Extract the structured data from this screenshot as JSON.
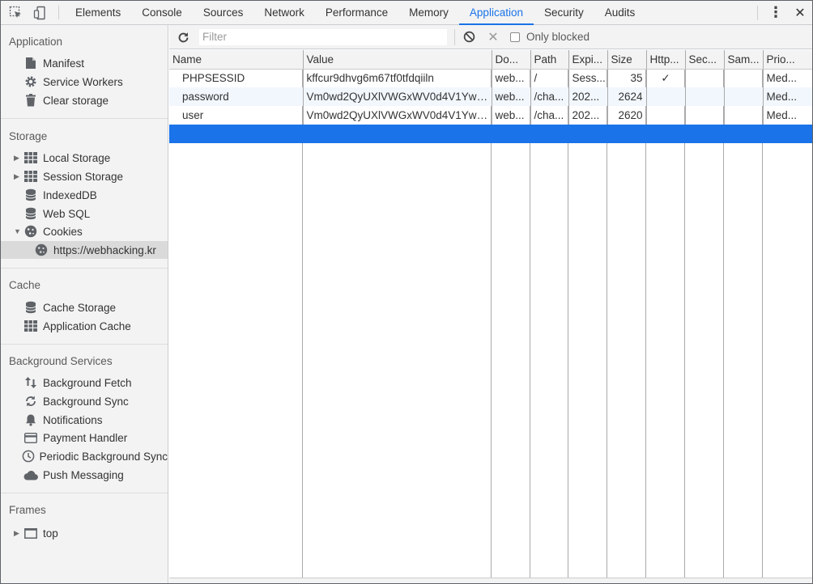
{
  "topbar": {
    "tabs": [
      "Elements",
      "Console",
      "Sources",
      "Network",
      "Performance",
      "Memory",
      "Application",
      "Security",
      "Audits"
    ],
    "active_tab": "Application",
    "close_glyph": "✕",
    "menu_glyph": "⋮"
  },
  "sidebar": {
    "application": {
      "title": "Application",
      "items": [
        "Manifest",
        "Service Workers",
        "Clear storage"
      ]
    },
    "storage": {
      "title": "Storage",
      "items": [
        "Local Storage",
        "Session Storage",
        "IndexedDB",
        "Web SQL",
        "Cookies"
      ],
      "cookie_child": "https://webhacking.kr"
    },
    "cache": {
      "title": "Cache",
      "items": [
        "Cache Storage",
        "Application Cache"
      ]
    },
    "background_services": {
      "title": "Background Services",
      "items": [
        "Background Fetch",
        "Background Sync",
        "Notifications",
        "Payment Handler",
        "Periodic Background Sync",
        "Push Messaging"
      ]
    },
    "frames": {
      "title": "Frames",
      "items": [
        "top"
      ]
    }
  },
  "toolbar": {
    "filter_placeholder": "Filter",
    "only_blocked_label": "Only blocked"
  },
  "cookies_table": {
    "headers": [
      "Name",
      "Value",
      "Do...",
      "Path",
      "Expi...",
      "Size",
      "Http...",
      "Sec...",
      "Sam...",
      "Prio..."
    ],
    "rows": [
      [
        "PHPSESSID",
        "kffcur9dhvg6m67tf0tfdqiiln",
        "web...",
        "/",
        "Sess...",
        "35",
        "✓",
        "",
        "",
        "Med..."
      ],
      [
        "password",
        "Vm0wd2QyUXlVWGxWV0d4V1YwZ...",
        "web...",
        "/cha...",
        "202...",
        "2624",
        "",
        "",
        "",
        "Med..."
      ],
      [
        "user",
        "Vm0wd2QyUXlVWGxWV0d4V1YwZ...",
        "web...",
        "/cha...",
        "202...",
        "2620",
        "",
        "",
        "",
        "Med..."
      ]
    ]
  },
  "colors": {
    "accent": "#1a73e8",
    "panel_bg": "#f3f3f3",
    "selected_row": "#1a73e8"
  }
}
